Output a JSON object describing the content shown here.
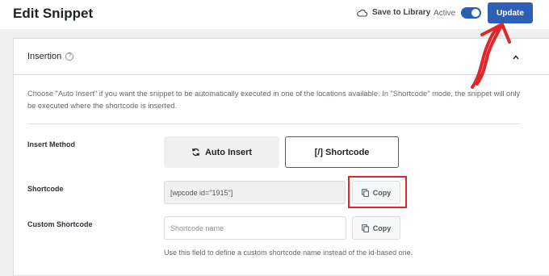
{
  "header": {
    "title": "Edit Snippet",
    "save_to_library": "Save to Library",
    "active_label": "Active",
    "update_label": "Update",
    "accent_color": "#2c5db6"
  },
  "panel": {
    "title": "Insertion",
    "help_symbol": "?",
    "description": "Choose \"Auto Insert\" if you want the snippet to be automatically executed in one of the locations available. In \"Shortcode\" mode, the snippet will only be executed where the shortcode is inserted.",
    "insert_method": {
      "label": "Insert Method",
      "options": [
        {
          "label": "Auto Insert",
          "icon": "refresh-icon",
          "selected": false
        },
        {
          "label": "[/] Shortcode",
          "selected": true
        }
      ]
    },
    "shortcode": {
      "label": "Shortcode",
      "value": "[wpcode id=\"1915\"]",
      "copy_label": "Copy"
    },
    "custom_shortcode": {
      "label": "Custom Shortcode",
      "placeholder": "Shortcode name",
      "copy_label": "Copy",
      "help": "Use this field to define a custom shortcode name instead of the id-based one."
    }
  },
  "annotation": {
    "highlight_color": "#e0262b"
  }
}
